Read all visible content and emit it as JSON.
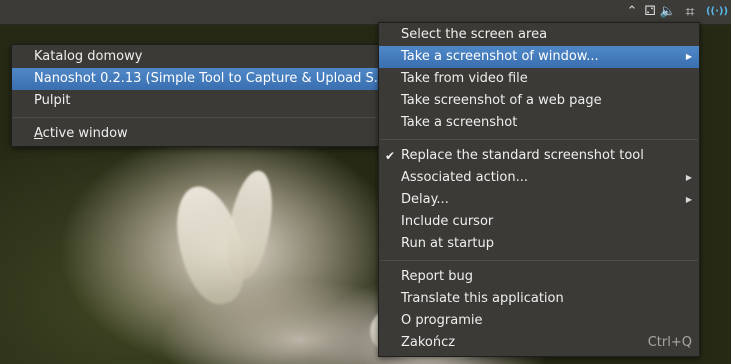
{
  "tray": [
    {
      "icon": "chevron-up-icon",
      "glyph": "⌃"
    },
    {
      "icon": "network-wired-icon",
      "glyph": "⚁"
    },
    {
      "icon": "volume-icon",
      "glyph": "🔈"
    },
    {
      "icon": "screenshot-tool-icon",
      "glyph": "⌗"
    },
    {
      "icon": "wireless-broadcast-icon",
      "glyph": "((·))"
    }
  ],
  "window_submenu": {
    "items": [
      {
        "label": "Katalog domowy"
      },
      {
        "label": "Nanoshot 0.2.13 (Simple Tool to Capture & Upload S..."
      },
      {
        "label": "Pulpit"
      },
      {
        "active_prefix": "A",
        "active_rest": "ctive window"
      }
    ]
  },
  "main_menu": {
    "capture": [
      {
        "label": "Select the screen area"
      },
      {
        "label": "Take a screenshot of window..."
      },
      {
        "label": "Take from video file"
      },
      {
        "label": "Take screenshot of a web page"
      },
      {
        "label": "Take a screenshot"
      }
    ],
    "options": [
      {
        "label": "Replace the standard screenshot tool",
        "checked": "✔"
      },
      {
        "label": "Associated action..."
      },
      {
        "label": "Delay..."
      },
      {
        "label": "Include cursor"
      },
      {
        "label": "Run at startup"
      }
    ],
    "about": [
      {
        "label": "Report bug"
      },
      {
        "label": "Translate this application"
      },
      {
        "label": "O programie"
      },
      {
        "label": "Zakończ",
        "shortcut": "Ctrl+Q"
      }
    ],
    "submenu_arrow": "▶"
  }
}
